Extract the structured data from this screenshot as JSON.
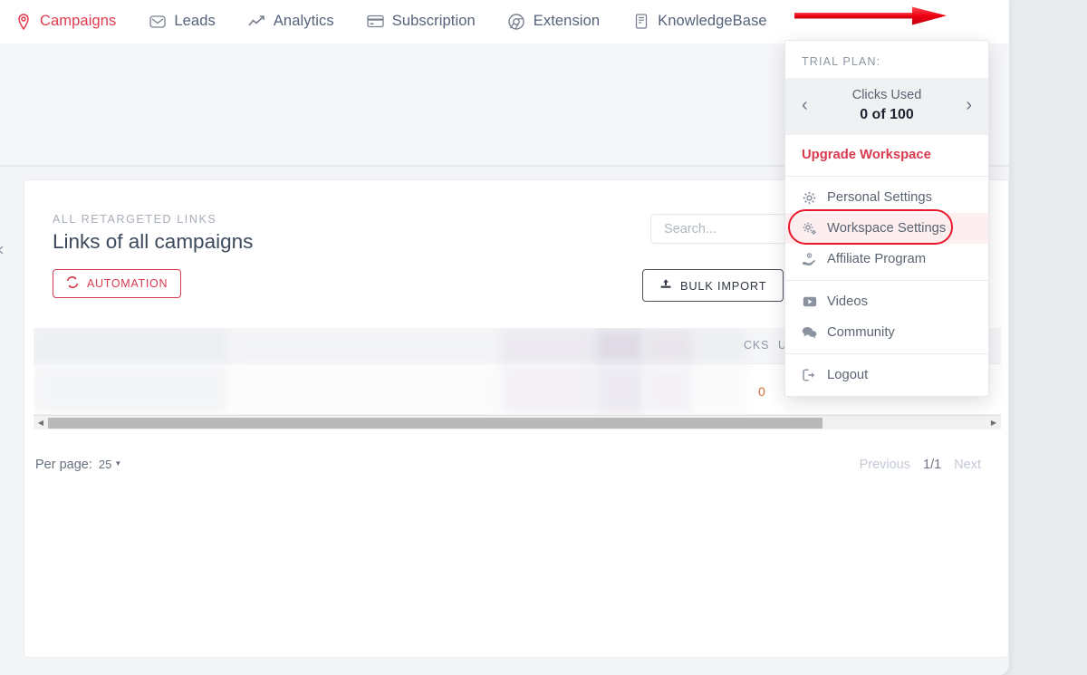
{
  "topnav": {
    "items": [
      {
        "label": "Campaigns",
        "icon": "pin-icon",
        "active": true
      },
      {
        "label": "Leads",
        "icon": "envelope-icon",
        "active": false
      },
      {
        "label": "Analytics",
        "icon": "chart-line-icon",
        "active": false
      },
      {
        "label": "Subscription",
        "icon": "credit-card-icon",
        "active": false
      },
      {
        "label": "Extension",
        "icon": "chrome-icon",
        "active": false
      },
      {
        "label": "KnowledgeBase",
        "icon": "book-icon",
        "active": false
      }
    ]
  },
  "panel": {
    "eyebrow": "ALL RETARGETED LINKS",
    "title": "Links of all campaigns",
    "automation_label": "AUTOMATION",
    "bulk_import_label": "BULK IMPORT",
    "search_placeholder": "Search...",
    "search_value": ""
  },
  "table": {
    "headers": [
      "CKS",
      "U"
    ],
    "clicks_value": "0"
  },
  "pagination": {
    "per_page_label": "Per page:",
    "per_page_value": "25",
    "previous_label": "Previous",
    "page_indicator": "1/1",
    "next_label": "Next"
  },
  "dropdown": {
    "plan_label": "TRIAL PLAN:",
    "clicks_label": "Clicks Used",
    "clicks_value": "0 of 100",
    "prev_arrow": "‹",
    "next_arrow": "›",
    "upgrade_label": "Upgrade Workspace",
    "groups": [
      {
        "items": [
          {
            "label": "Personal Settings",
            "icon": "gear-icon",
            "highlighted": false
          },
          {
            "label": "Workspace Settings",
            "icon": "gears-icon",
            "highlighted": true
          },
          {
            "label": "Affiliate Program",
            "icon": "hand-money-icon",
            "highlighted": false
          }
        ]
      },
      {
        "items": [
          {
            "label": "Videos",
            "icon": "video-icon",
            "highlighted": false
          },
          {
            "label": "Community",
            "icon": "comments-icon",
            "highlighted": false
          }
        ]
      },
      {
        "items": [
          {
            "label": "Logout",
            "icon": "logout-icon",
            "highlighted": false
          }
        ]
      }
    ]
  },
  "colors": {
    "brand_red": "#d93a4f",
    "annotation_red": "#e8192c",
    "nav_text": "#55627a",
    "panel_title": "#3d4a5c"
  }
}
